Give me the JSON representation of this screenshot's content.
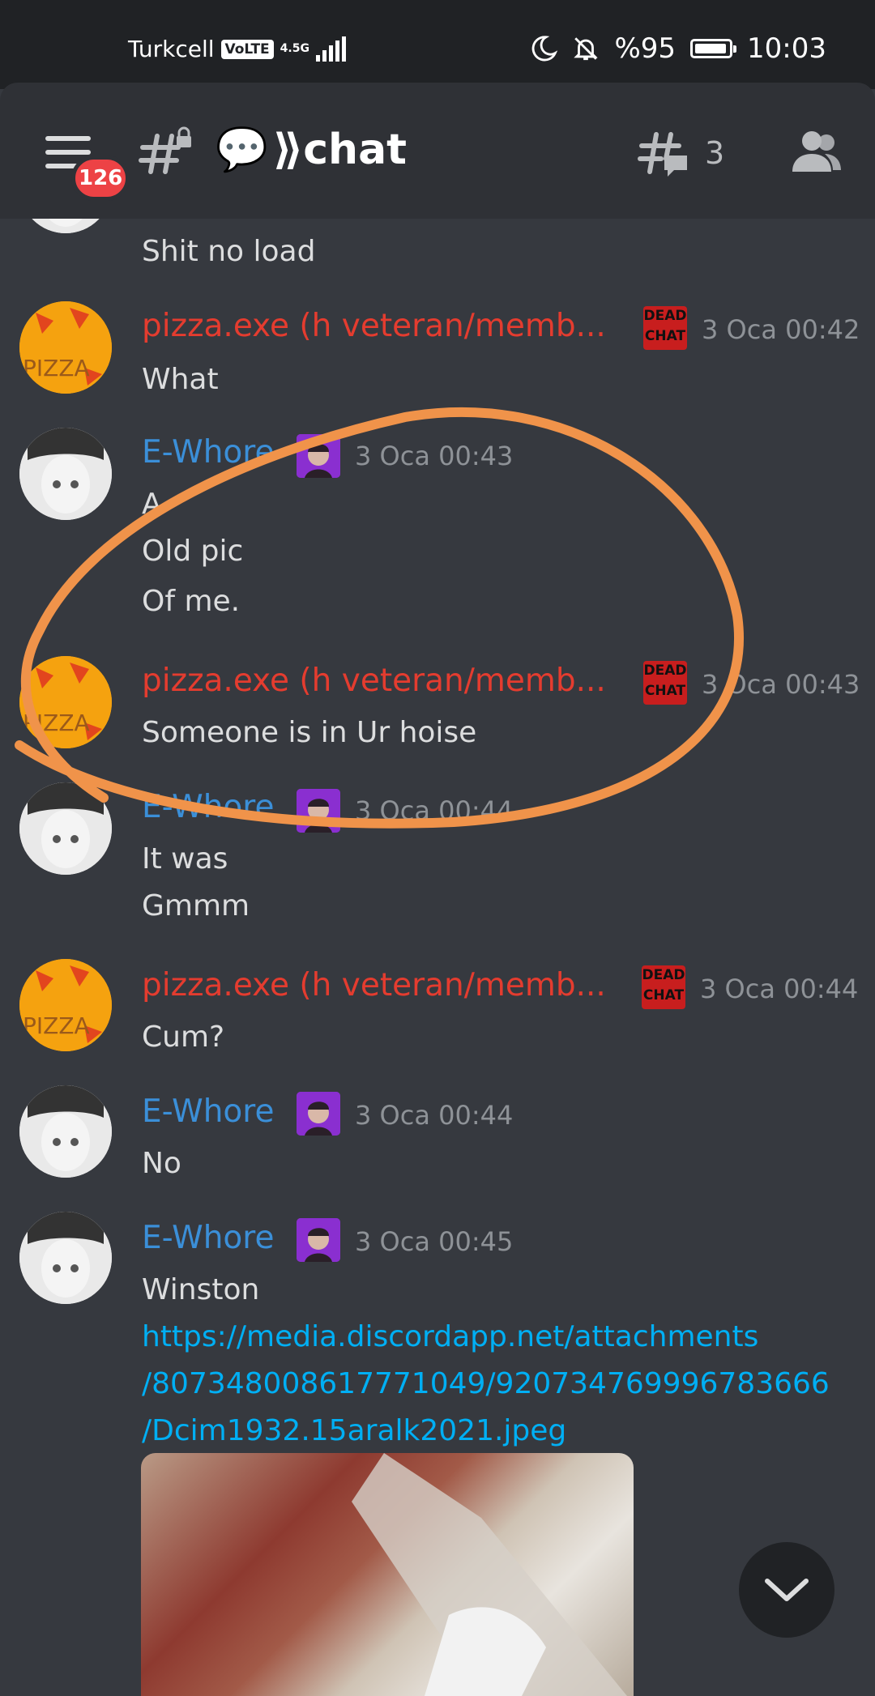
{
  "status_bar": {
    "carrier": "Turkcell",
    "volte": "VoLTE",
    "network": "4.5G",
    "battery_text": "%95",
    "battery_level": 0.95,
    "time": "10:03"
  },
  "header": {
    "unread_badge": "126",
    "channel_emoji": "💬",
    "channel_name": "⟫chat",
    "thread_count": "3"
  },
  "messages": [
    {
      "text": "Shit no load"
    },
    {
      "username": "pizza.exe (h veteran/memb...",
      "role_badge": [
        "DEAD",
        "CHAT"
      ],
      "timestamp": "3 Oca 00:42",
      "lines": [
        "What"
      ]
    },
    {
      "username": "E-Whore",
      "timestamp": "3 Oca 00:43",
      "lines": [
        "A",
        "Old pic",
        "Of me."
      ]
    },
    {
      "username": "pizza.exe (h veteran/memb...",
      "role_badge": [
        "DEAD",
        "CHAT"
      ],
      "timestamp": "3 Oca 00:43",
      "lines": [
        "Someone is in Ur hoise"
      ]
    },
    {
      "username": "E-Whore",
      "timestamp": "3 Oca 00:44",
      "lines": [
        "It was",
        "Gmmm"
      ]
    },
    {
      "username": "pizza.exe (h veteran/memb...",
      "role_badge": [
        "DEAD",
        "CHAT"
      ],
      "timestamp": "3 Oca 00:44",
      "lines": [
        "Cum?"
      ]
    },
    {
      "username": "E-Whore",
      "timestamp": "3 Oca 00:44",
      "lines": [
        "No"
      ]
    },
    {
      "username": "E-Whore",
      "timestamp": "3 Oca 00:45",
      "lines": [
        "Winston"
      ],
      "link_lines": [
        "https://media.discordapp.net/attachments",
        "/807348008617771049/920734769996783666",
        "/Dcim1932.15aralk2021.jpeg"
      ]
    }
  ],
  "avatar_text": "PIZZA",
  "colors": {
    "pizza_name": "#e43c2f",
    "ewhore_name": "#3b8fd8",
    "annotation": "#f0934a",
    "link": "#00aff4"
  }
}
